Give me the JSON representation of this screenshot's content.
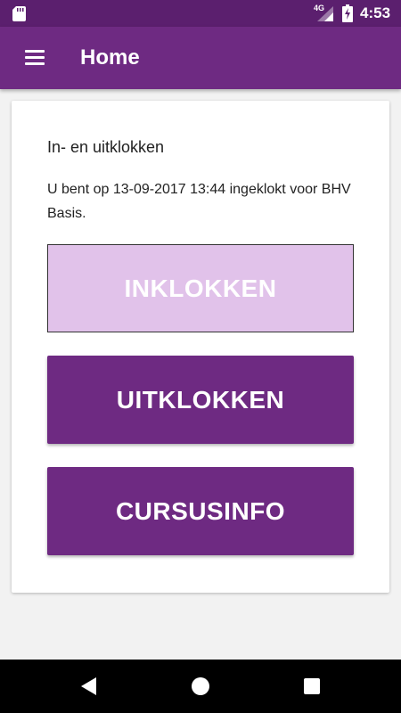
{
  "status_bar": {
    "network": "4G",
    "time": "4:53",
    "icons": [
      "sd-card-icon",
      "signal-icon",
      "battery-charging-icon"
    ]
  },
  "app_bar": {
    "title": "Home",
    "menu_icon": "hamburger-menu-icon"
  },
  "card": {
    "title": "In- en uitklokken",
    "status_text": "U bent op 13-09-2017 13:44 ingeklokt voor BHV Basis."
  },
  "buttons": {
    "clock_in": "INKLOKKEN",
    "clock_out": "UITKLOKKEN",
    "course_info": "CURSUSINFO"
  },
  "nav_bar": {
    "icons": [
      "back-icon",
      "home-icon",
      "recents-icon"
    ]
  },
  "colors": {
    "status_bar": "#5b1f6e",
    "primary": "#6e2a82",
    "disabled_button": "#e1c2ea",
    "background": "#f2f2f2"
  }
}
